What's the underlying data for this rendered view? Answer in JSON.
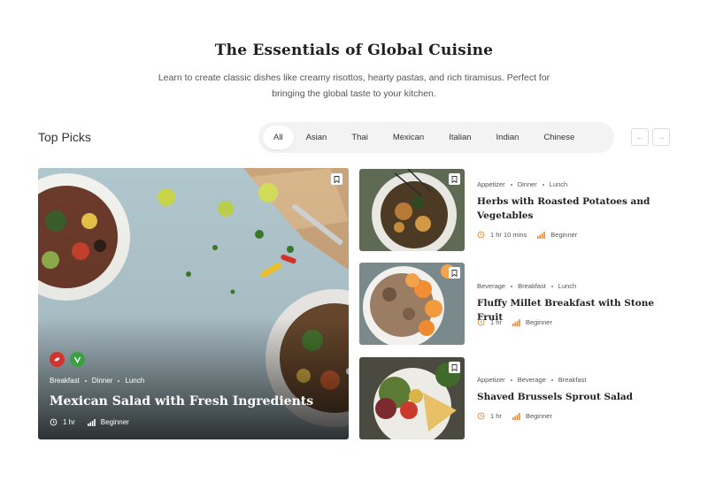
{
  "hero": {
    "title": "The Essentials of Global Cuisine",
    "subtitle": "Learn to create classic dishes like creamy risottos, hearty pastas, and rich tiramisus. Perfect for bringing the global taste to your kitchen."
  },
  "section": {
    "heading": "Top Picks"
  },
  "filters": [
    "All",
    "Asian",
    "Thai",
    "Mexican",
    "Italian",
    "Indian",
    "Chinese"
  ],
  "filters_active": "All",
  "featured": {
    "tags": [
      "Breakfast",
      "Dinner",
      "Lunch"
    ],
    "title": "Mexican Salad with Fresh Ingredients",
    "time": "1 hr",
    "level": "Beginner",
    "badges": [
      "chili-icon",
      "vegan-icon"
    ]
  },
  "cards": [
    {
      "tags": [
        "Appetizer",
        "Dinner",
        "Lunch"
      ],
      "title": "Herbs with Roasted Potatoes and Vegetables",
      "time": "1 hr 10 mins",
      "level": "Beginner"
    },
    {
      "tags": [
        "Beverage",
        "Breakfast",
        "Lunch"
      ],
      "title": "Fluffy Millet Breakfast with Stone Fruit",
      "time": "1 hr",
      "level": "Beginner"
    },
    {
      "tags": [
        "Appetizer",
        "Beverage",
        "Breakfast"
      ],
      "title": "Shaved Brussels Sprout Salad",
      "time": "1 hr",
      "level": "Beginner"
    }
  ],
  "colors": {
    "accent_orange": "#e5893a",
    "chili_badge": "#d0342c",
    "vegan_badge": "#3aa040"
  }
}
